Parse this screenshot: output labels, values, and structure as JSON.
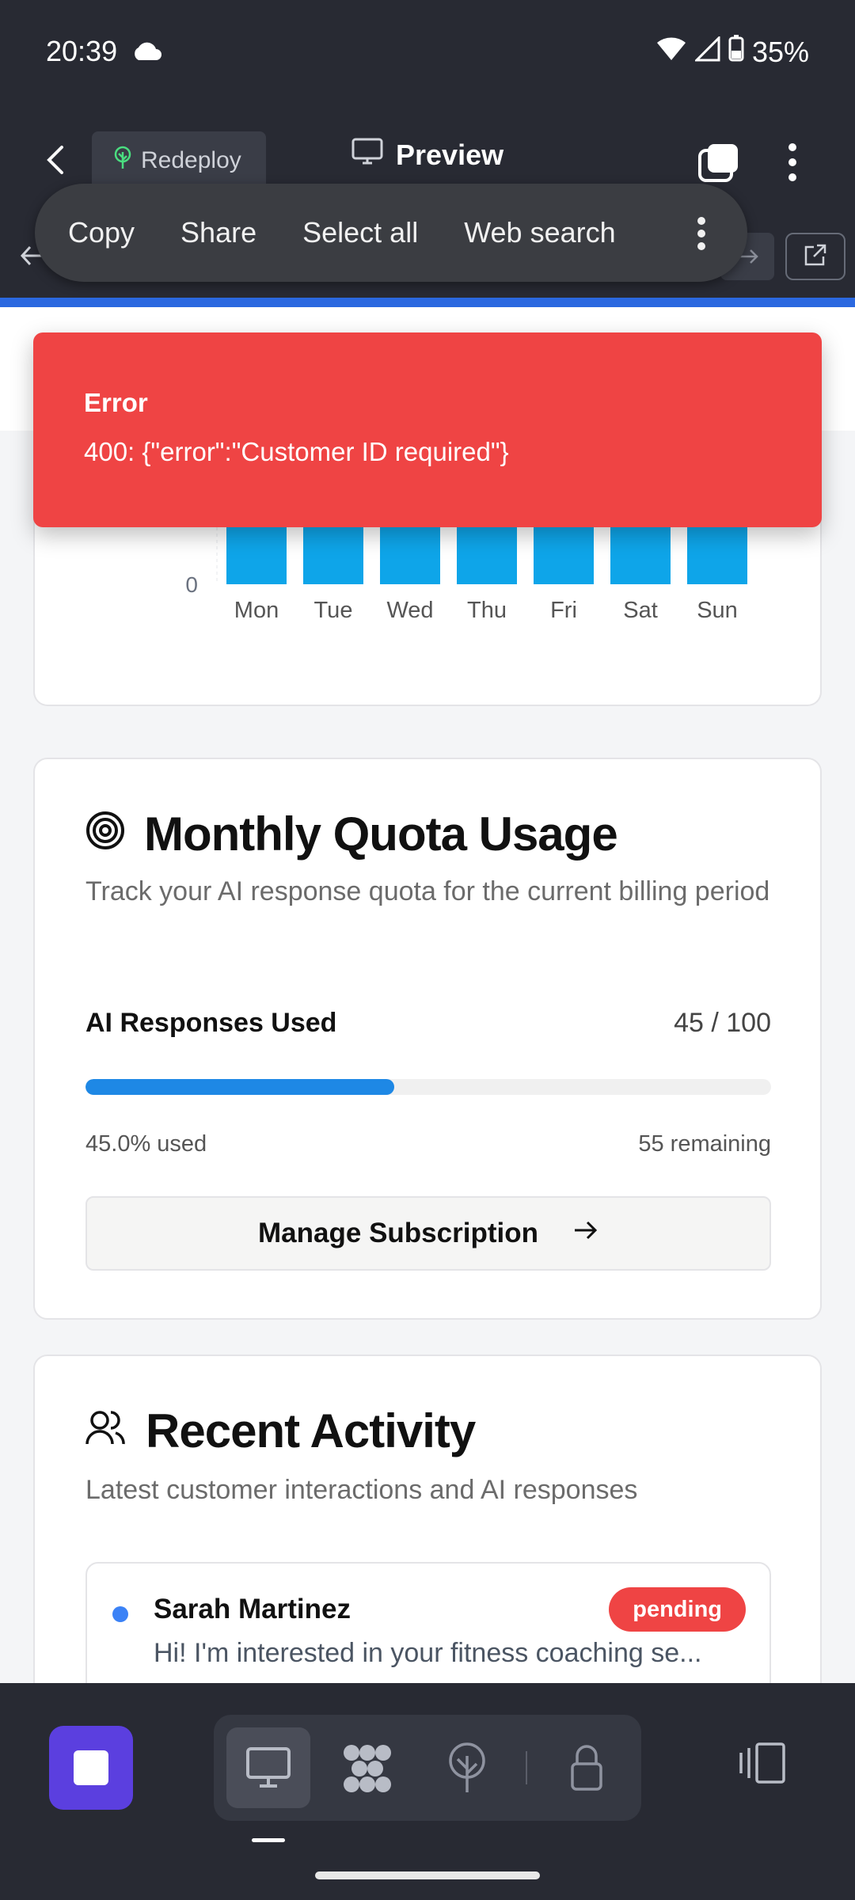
{
  "status_bar": {
    "time": "20:39",
    "battery": "35%"
  },
  "app_header": {
    "redeploy_label": "Redeploy",
    "preview_label": "Preview"
  },
  "context_menu": {
    "items": [
      "Copy",
      "Share",
      "Select all",
      "Web search"
    ]
  },
  "error_toast": {
    "title": "Error",
    "message": "400: {\"error\":\"Customer ID required\"}"
  },
  "chart_data": {
    "type": "bar",
    "categories": [
      "Mon",
      "Tue",
      "Wed",
      "Thu",
      "Fri",
      "Sat",
      "Sun"
    ],
    "values": [
      0,
      0,
      0,
      0,
      0,
      0,
      0
    ],
    "y_ticks": [
      "0"
    ],
    "color": "#0ea5e9"
  },
  "quota": {
    "title": "Monthly Quota Usage",
    "subtitle": "Track your AI response quota for the current billing period",
    "used_label": "AI Responses Used",
    "used_value": "45 / 100",
    "progress_fraction": 0.45,
    "percent_text": "45.0% used",
    "remaining_text": "55 remaining",
    "manage_button": "Manage Subscription"
  },
  "activity": {
    "title": "Recent Activity",
    "subtitle": "Latest customer interactions and AI responses",
    "items": [
      {
        "name": "Sarah Martinez",
        "status": "pending",
        "message": "Hi! I'm interested in your fitness coaching se..."
      }
    ]
  },
  "colors": {
    "accent_blue": "#1e88e5",
    "error_red": "#ef4444",
    "dark_chrome": "#282a33",
    "home_purple": "#5b3fdf"
  }
}
